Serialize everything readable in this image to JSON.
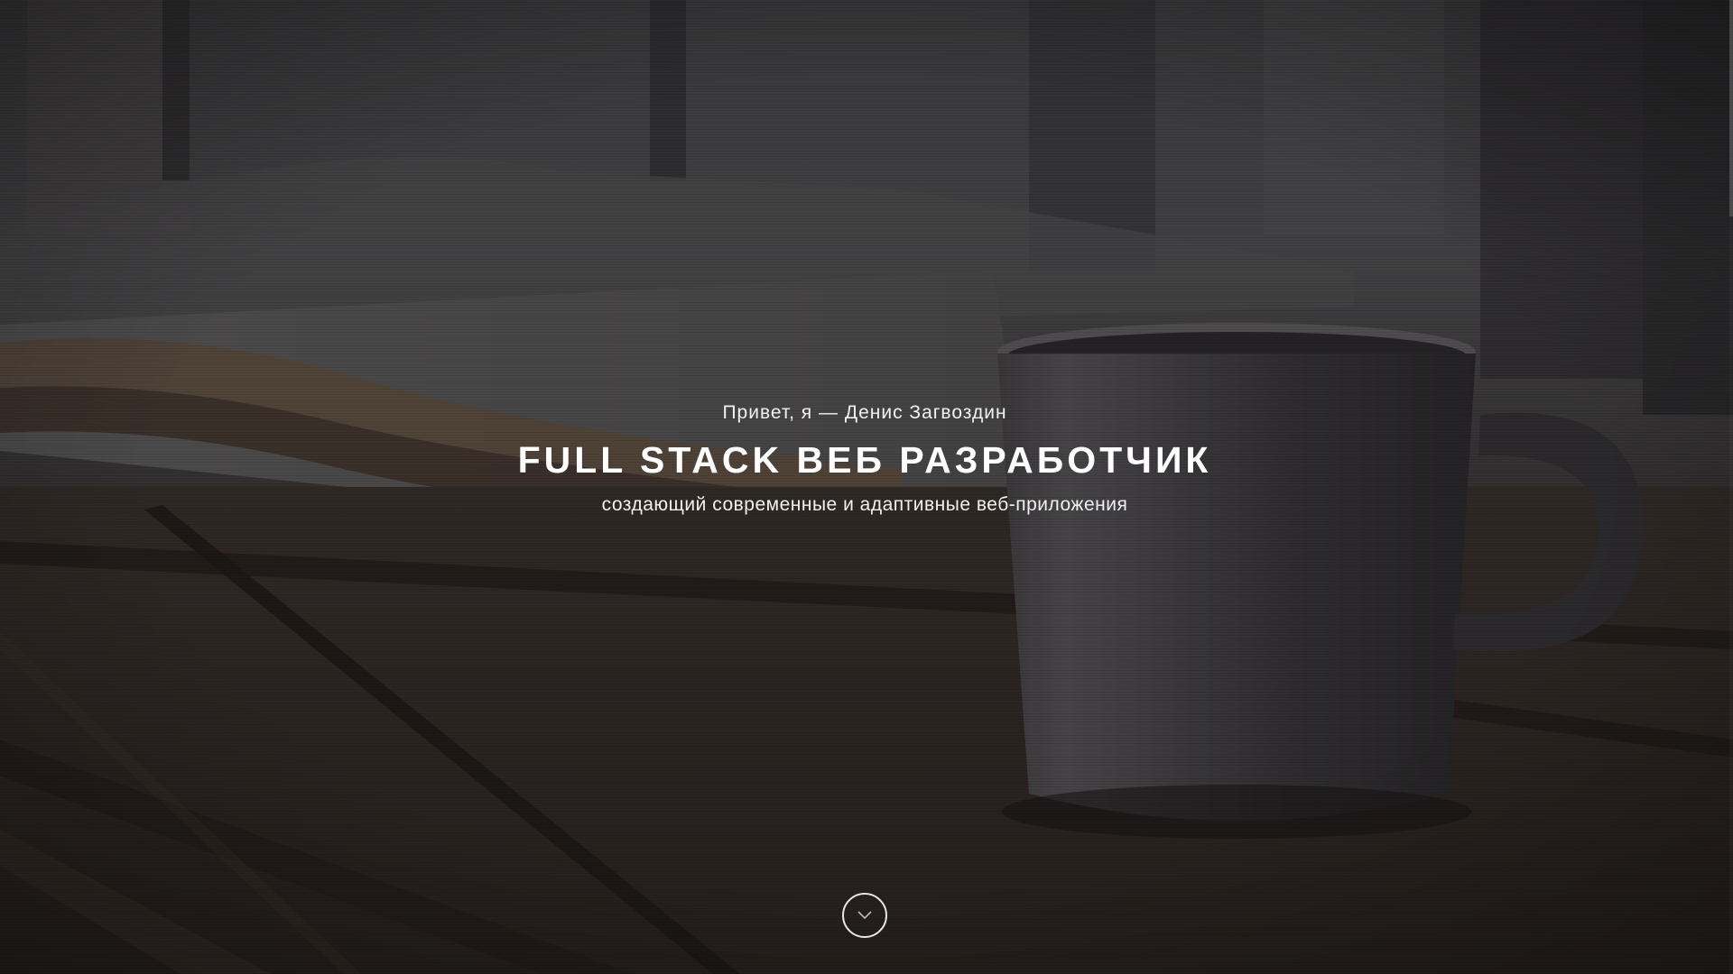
{
  "hero": {
    "greeting": "Привет, я — Денис Загвоздин",
    "title": "FULL STACK ВЕБ РАЗРАБОТЧИК",
    "subtitle": "создающий современные и адаптивные веб-приложения",
    "scroll_icon": "chevron-down-icon"
  },
  "colors": {
    "text": "#ffffff",
    "overlay": "#191616",
    "button_border": "#e6e6e6"
  }
}
